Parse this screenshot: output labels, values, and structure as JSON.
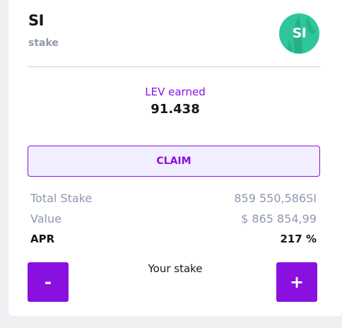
{
  "pool": {
    "token_symbol": "SI",
    "type_label": "stake",
    "logo": {
      "icon": "si-token-logo-icon",
      "text": "SI",
      "color": "#2ec79b"
    }
  },
  "earned": {
    "label": "LEV earned",
    "value": "91.438"
  },
  "claim_button": {
    "label": "CLAIM"
  },
  "stats": {
    "total_stake": {
      "label": "Total Stake",
      "value": "859 550,586SI"
    },
    "value": {
      "label": "Value",
      "value": "$ 865 854,99"
    },
    "apr": {
      "label": "APR",
      "value": "217 %"
    }
  },
  "stake_controls": {
    "label": "Your stake",
    "minus_label": "-",
    "plus_label": "+"
  },
  "colors": {
    "accent": "#8a10e0",
    "accent_light_bg": "#f1efff",
    "muted_text": "#8e98ae",
    "dark_text": "#15151f",
    "logo_green": "#2ec79b"
  }
}
